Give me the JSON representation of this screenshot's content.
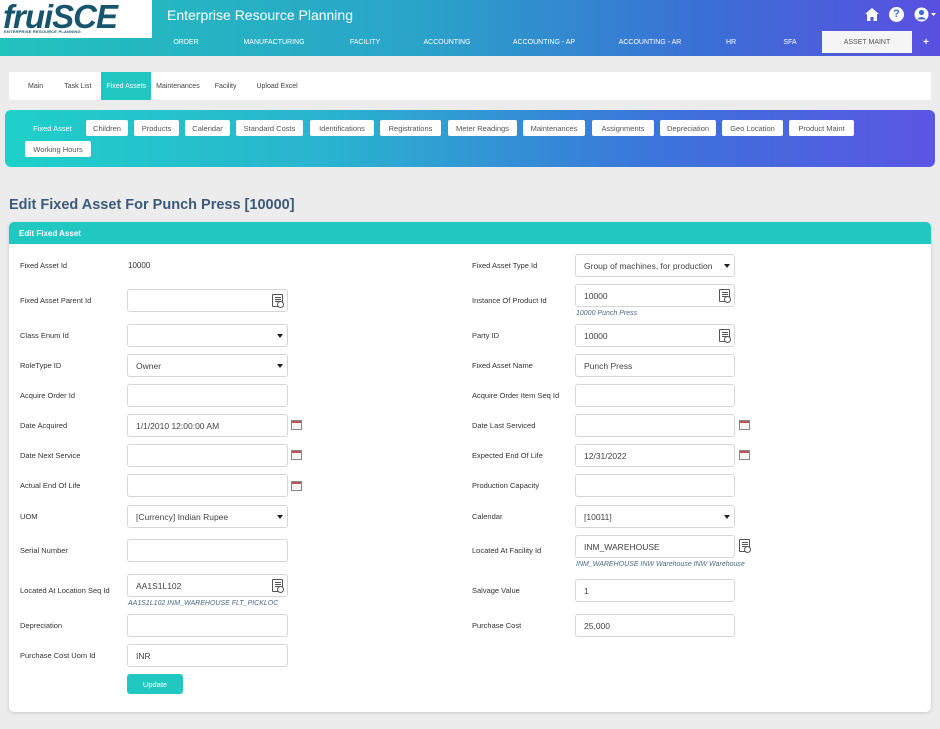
{
  "brand": {
    "logo": "fruiSCE",
    "tagline": "ENTERPRISE RESOURCE PLANNING"
  },
  "app_title": "Enterprise Resource Planning",
  "header_icons": [
    "home-icon",
    "help-icon",
    "user-icon"
  ],
  "help_glyph": "?",
  "topnav": [
    "ORDER",
    "MANUFACTURING",
    "FACILITY",
    "ACCOUNTING",
    "ACCOUNTING - AP",
    "ACCOUNTING - AR",
    "HR",
    "SFA",
    "ASSET MAINT",
    "+"
  ],
  "active_topnav": "ASSET MAINT",
  "subtabs": [
    "Main",
    "Task List",
    "Fixed Assets",
    "Maintenances",
    "Facility",
    "Upload Excel"
  ],
  "active_subtab": "Fixed Assets",
  "buttons": [
    "Fixed Asset",
    "Children",
    "Products",
    "Calendar",
    "Standard Costs",
    "Identifications",
    "Registrations",
    "Meter Readings",
    "Maintenances",
    "Assignments",
    "Depreciation",
    "Geo Location",
    "Product Maint",
    "Working Hours"
  ],
  "page_title": "Edit Fixed Asset For Punch Press [10000]",
  "panel_title": "Edit Fixed Asset",
  "left": {
    "fixed_asset_id": {
      "label": "Fixed Asset Id",
      "value": "10000"
    },
    "parent_id": {
      "label": "Fixed Asset Parent Id",
      "value": ""
    },
    "class_enum": {
      "label": "Class Enum Id",
      "value": ""
    },
    "role_type": {
      "label": "RoleType ID",
      "value": "Owner"
    },
    "acquire_order": {
      "label": "Acquire Order Id",
      "value": ""
    },
    "date_acquired": {
      "label": "Date Acquired",
      "value": "1/1/2010 12:00:00 AM"
    },
    "date_next_service": {
      "label": "Date Next Service",
      "value": ""
    },
    "actual_end": {
      "label": "Actual End Of Life",
      "value": ""
    },
    "uom": {
      "label": "UOM",
      "value": "[Currency] Indian Rupee"
    },
    "serial": {
      "label": "Serial Number",
      "value": ""
    },
    "location_seq": {
      "label": "Located At Location Seq Id",
      "value": "AA1S1L102",
      "hint": "AA1S1L102 INM_WAREHOUSE FLT_PICKLOC"
    },
    "depreciation": {
      "label": "Depreciation",
      "value": ""
    },
    "purchase_cost_uom": {
      "label": "Purchase Cost Uom Id",
      "value": "INR"
    }
  },
  "right": {
    "type_id": {
      "label": "Fixed Asset Type Id",
      "value": "Group of machines, for production"
    },
    "instance_product": {
      "label": "Instance Of Product Id",
      "value": "10000",
      "hint": "10000 Punch Press"
    },
    "party_id": {
      "label": "Party ID",
      "value": "10000"
    },
    "asset_name": {
      "label": "Fixed Asset Name",
      "value": "Punch Press"
    },
    "acquire_item": {
      "label": "Acquire Order Item Seq Id",
      "value": ""
    },
    "date_last_serviced": {
      "label": "Date Last Serviced",
      "value": ""
    },
    "expected_end": {
      "label": "Expected End Of Life",
      "value": "12/31/2022"
    },
    "production_capacity": {
      "label": "Production Capacity",
      "value": ""
    },
    "calendar": {
      "label": "Calendar",
      "value": "[10011]"
    },
    "facility_id": {
      "label": "Located At Facility Id",
      "value": "INM_WAREHOUSE",
      "hint": "INM_WAREHOUSE INW Warehouse INW Warehouse"
    },
    "salvage": {
      "label": "Salvage Value",
      "value": "1"
    },
    "purchase_cost": {
      "label": "Purchase Cost",
      "value": "25,000"
    }
  },
  "update_label": "Update",
  "colors": {
    "accent": "#21c7c1",
    "title": "#3c5a7a",
    "gradient_end": "#5a4fe0"
  }
}
